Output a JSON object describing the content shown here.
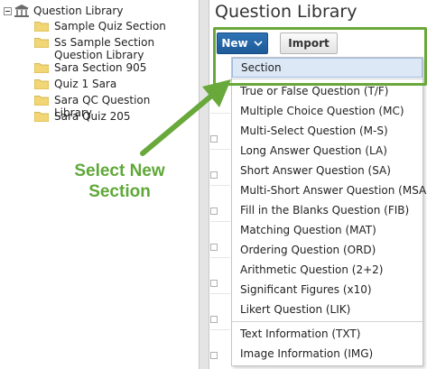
{
  "tree": {
    "root_label": "Question Library",
    "items": [
      {
        "label": "Sample Quiz Section"
      },
      {
        "label": "Ss Sample Section Question Library"
      },
      {
        "label": "Sara Section 905"
      },
      {
        "label": "Quiz 1 Sara"
      },
      {
        "label": "Sara QC Question Library"
      },
      {
        "label": "Sara Quiz 205"
      }
    ]
  },
  "main": {
    "title": "Question Library",
    "toolbar": {
      "new_label": "New",
      "import_label": "Import"
    }
  },
  "menu": {
    "items": [
      {
        "label": "Section"
      },
      {
        "label": "True or False Question (T/F)"
      },
      {
        "label": "Multiple Choice Question (MC)"
      },
      {
        "label": "Multi-Select Question (M-S)"
      },
      {
        "label": "Long Answer Question (LA)"
      },
      {
        "label": "Short Answer Question (SA)"
      },
      {
        "label": "Multi-Short Answer Question (MSA)"
      },
      {
        "label": "Fill in the Blanks Question (FIB)"
      },
      {
        "label": "Matching Question (MAT)"
      },
      {
        "label": "Ordering Question (ORD)"
      },
      {
        "label": "Arithmetic Question (2+2)"
      },
      {
        "label": "Significant Figures (x10)"
      },
      {
        "label": "Likert Question (LIK)"
      },
      {
        "label": "Text Information (TXT)"
      },
      {
        "label": "Image Information (IMG)"
      }
    ]
  },
  "annotation": {
    "text": "Select New Section"
  },
  "colors": {
    "accent_green": "#69a83a",
    "button_blue": "#2a6aad",
    "selected_bg": "#dce8f6",
    "folder_yellow": "#f2d675"
  },
  "icons": {
    "collapse": "minus-box-icon",
    "library": "library-building-icon",
    "folder": "folder-icon",
    "dropdown": "chevron-down-icon"
  }
}
